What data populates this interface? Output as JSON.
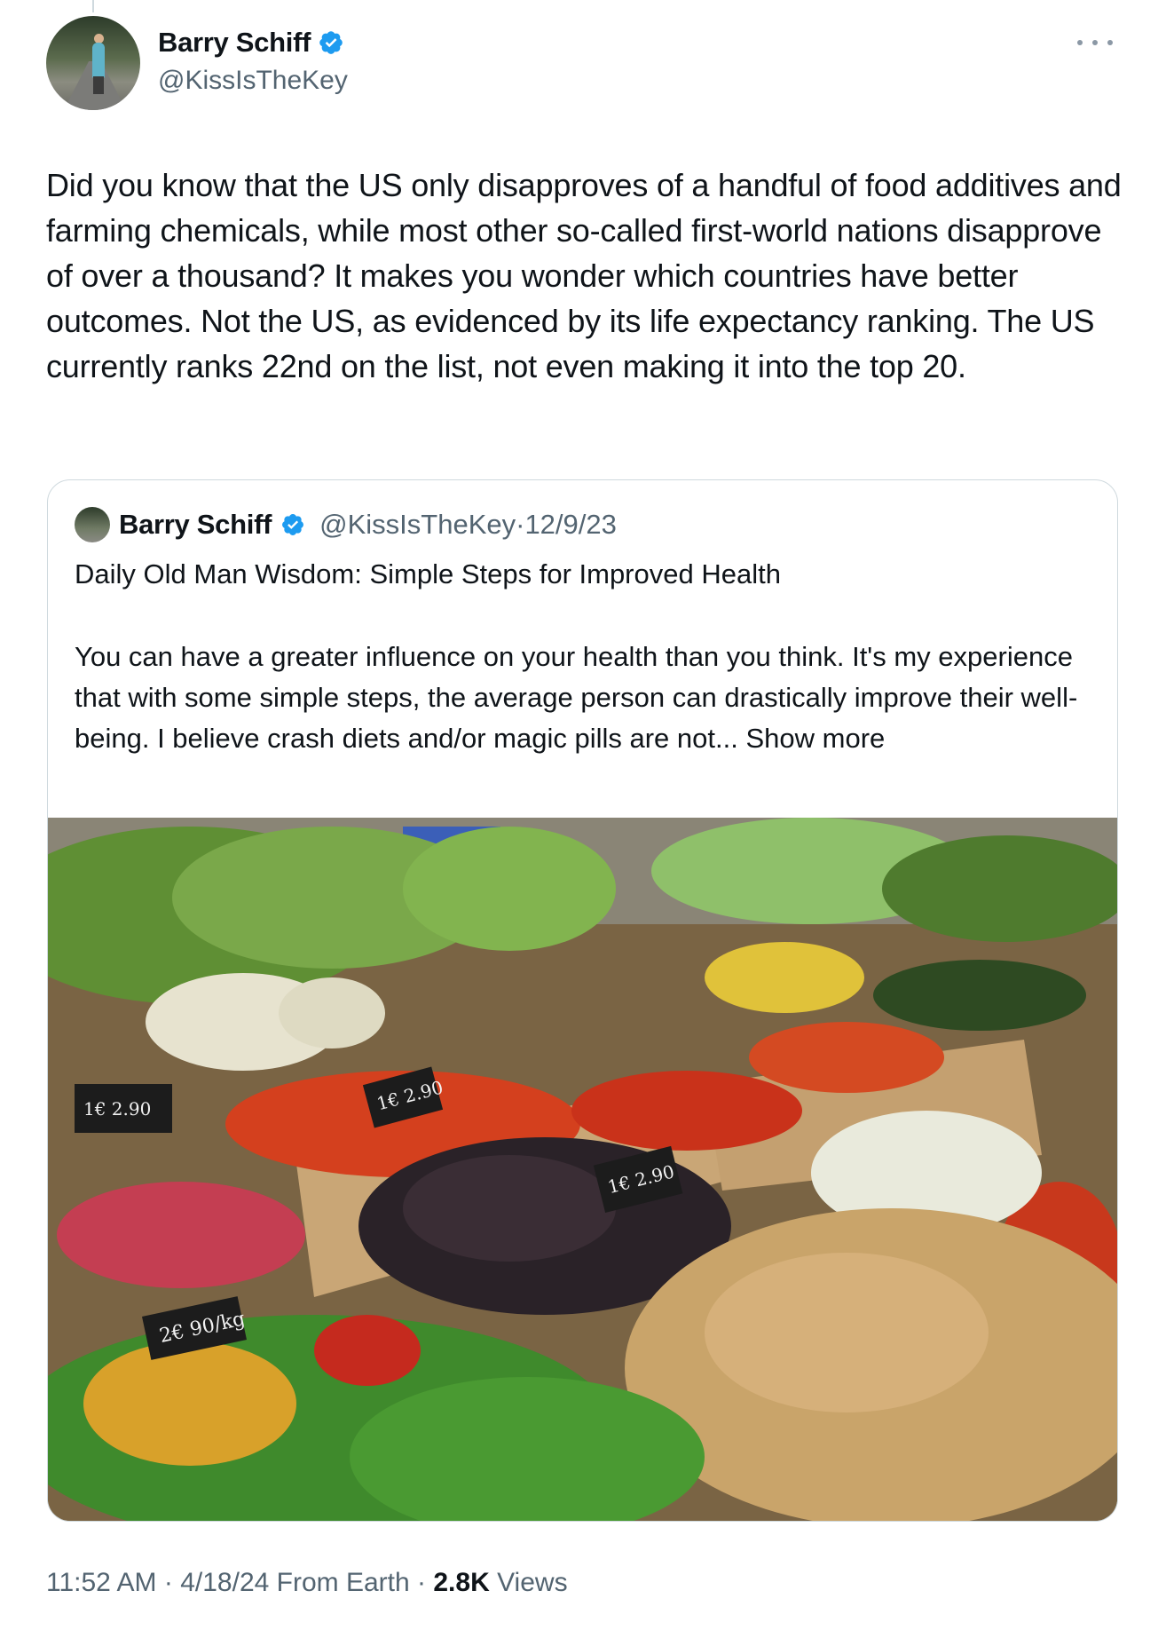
{
  "tweet": {
    "author": {
      "name": "Barry Schiff",
      "handle": "@KissIsTheKey",
      "verified": true
    },
    "text": "Did you know that the US only disapproves of a handful of food additives and farming chemicals, while most other so-called first-world nations disapprove of over a thousand? It makes you wonder which countries have better outcomes. Not the US, as evidenced by its life expectancy ranking. The US currently ranks 22nd on the list, not even making it into the top 20.",
    "time": "11:52 AM",
    "date": "4/18/24",
    "source": "From Earth",
    "views_count": "2.8K",
    "views_label": "Views",
    "separator": "·"
  },
  "quoted": {
    "author": {
      "name": "Barry Schiff",
      "handle": "@KissIsTheKey",
      "date": "12/9/23",
      "verified": true
    },
    "title": "Daily Old Man Wisdom: Simple Steps for Improved Health",
    "body": "You can have a greater influence on your health than you think. It's my experience that with some simple steps, the average person can drastically improve their well-being. I believe crash diets and/or magic pills are not...",
    "show_more": "Show more",
    "image": {
      "price_tags": [
        "2€ 90/kg",
        "1€ 2.90",
        "1€ 2.90",
        "1€ 2.90"
      ]
    }
  },
  "colors": {
    "verified": "#1d9bf0",
    "secondary_text": "#536471",
    "border": "#cfd9de"
  }
}
